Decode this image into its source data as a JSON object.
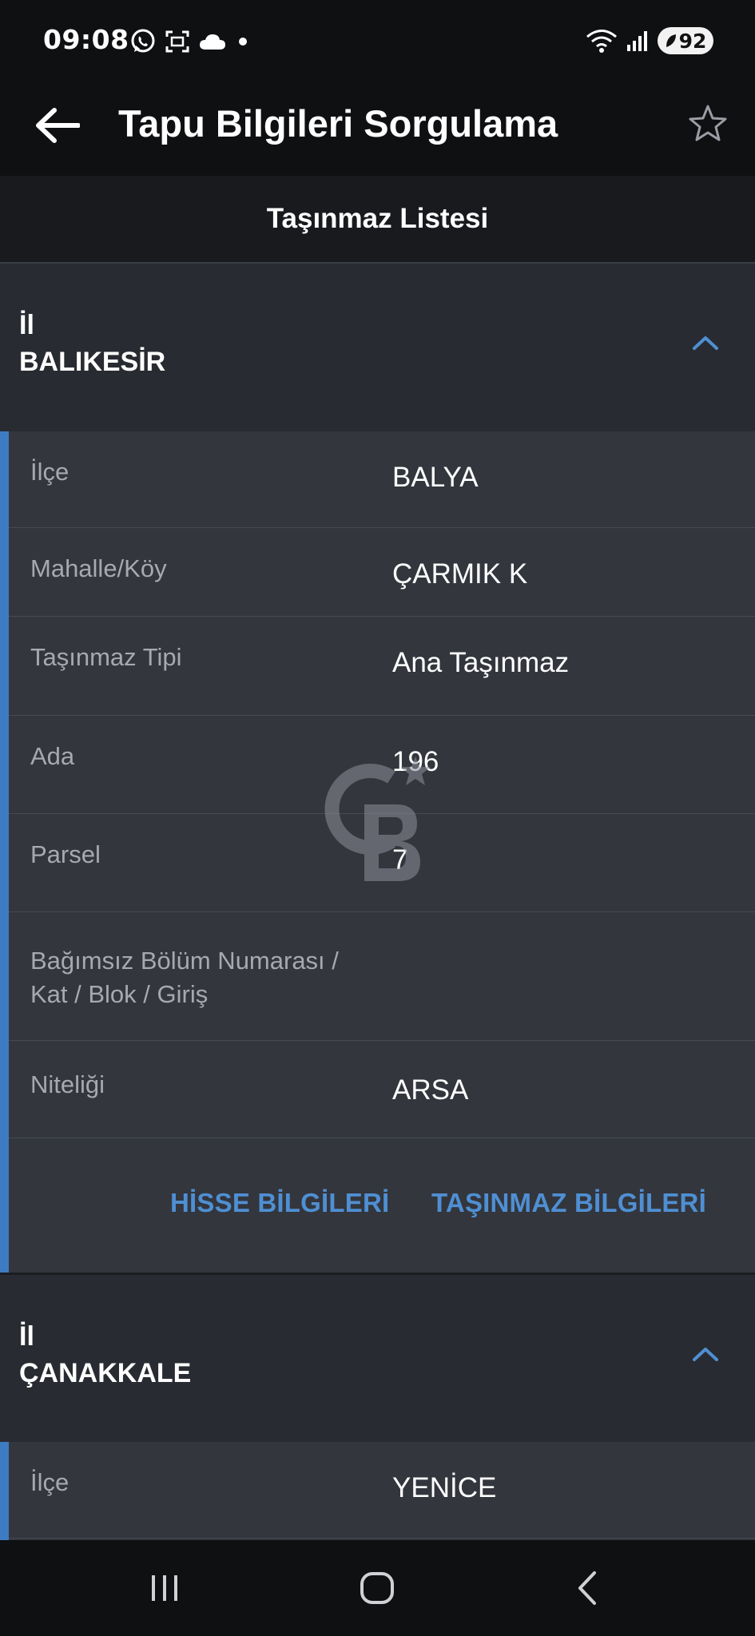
{
  "status_bar": {
    "time": "09:08",
    "battery": "92",
    "icons_left": [
      "whatsapp-icon",
      "screenshot-icon",
      "cloud-icon",
      "dot-icon"
    ],
    "icons_right": [
      "wifi-icon",
      "signal-icon",
      "battery-icon"
    ]
  },
  "app_bar": {
    "title": "Tapu Bilgileri Sorgulama",
    "back_icon": "arrow-left-icon",
    "favorite_icon": "star-outline-icon"
  },
  "sub_header": {
    "title": "Taşınmaz Listesi"
  },
  "groups": [
    {
      "label": "İl",
      "value": "BALIKESİR",
      "rows": [
        {
          "key": "İlçe",
          "value": "BALYA"
        },
        {
          "key": "Mahalle/Köy",
          "value": "ÇARMIK K"
        },
        {
          "key": "Taşınmaz Tipi",
          "value": "Ana Taşınmaz"
        },
        {
          "key": "Ada",
          "value": "196"
        },
        {
          "key": "Parsel",
          "value": "7"
        },
        {
          "key_line1": "Bağımsız Bölüm Numarası /",
          "key_line2": "Kat / Blok / Giriş",
          "value": ""
        },
        {
          "key": "Niteliği",
          "value": "ARSA"
        }
      ],
      "actions": {
        "share_info": "HİSSE BİLGİLERİ",
        "property_info": "TAŞINMAZ BİLGİLERİ"
      }
    },
    {
      "label": "İl",
      "value": "ÇANAKKALE",
      "rows": [
        {
          "key": "İlçe",
          "value": "YENİCE"
        }
      ]
    }
  ],
  "nav_bar": {
    "recents_icon": "recents-icon",
    "home_icon": "home-icon",
    "back_icon": "back-chevron-icon"
  },
  "colors": {
    "background": "#2b2e34",
    "header_bg": "#0f1012",
    "accent": "#3d7cc2",
    "link": "#4f8fd3",
    "muted_text": "#a6a9af"
  }
}
